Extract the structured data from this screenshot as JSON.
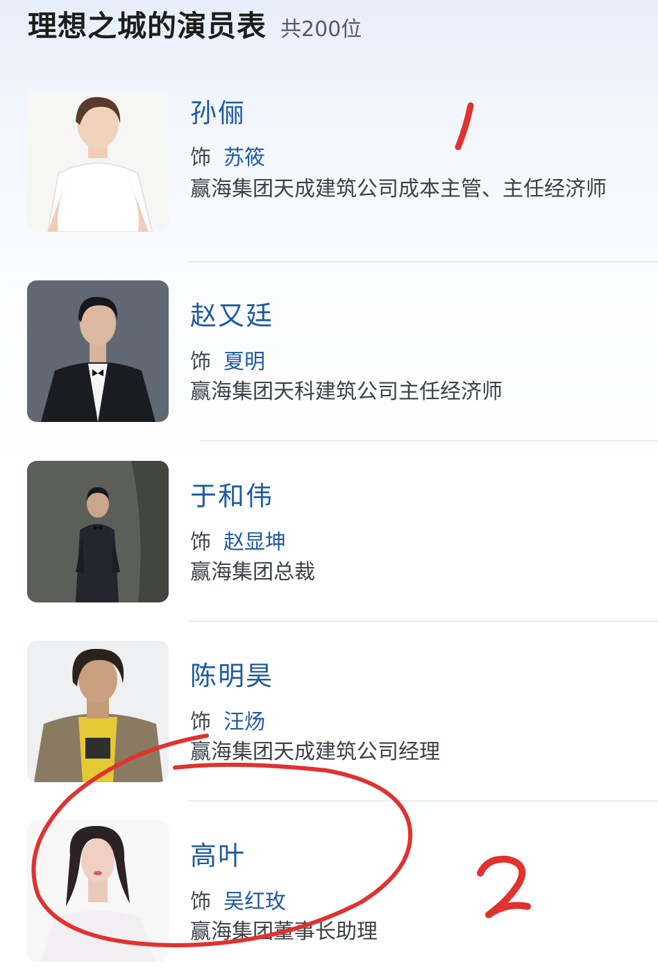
{
  "header": {
    "title": "理想之城的演员表",
    "count": "共200位"
  },
  "cast": [
    {
      "actor": "孙俪",
      "role_prefix": "饰",
      "role": "苏筱",
      "description": "赢海集团天成建筑公司成本主管、主任经济师"
    },
    {
      "actor": "赵又廷",
      "role_prefix": "饰",
      "role": "夏明",
      "description": "赢海集团天科建筑公司主任经济师"
    },
    {
      "actor": "于和伟",
      "role_prefix": "饰",
      "role": "赵显坤",
      "description": "赢海集团总裁"
    },
    {
      "actor": "陈明昊",
      "role_prefix": "饰",
      "role": "汪炀",
      "description": "赢海集团天成建筑公司经理"
    },
    {
      "actor": "高叶",
      "role_prefix": "饰",
      "role": "吴红玫",
      "description": "赢海集团董事长助理"
    }
  ],
  "annotations": {
    "mark_1": "1",
    "mark_2": "2",
    "color": "#e0322f"
  },
  "colors": {
    "link": "#1e5aa5",
    "text": "#3d4148",
    "title": "#1d1d1d"
  }
}
